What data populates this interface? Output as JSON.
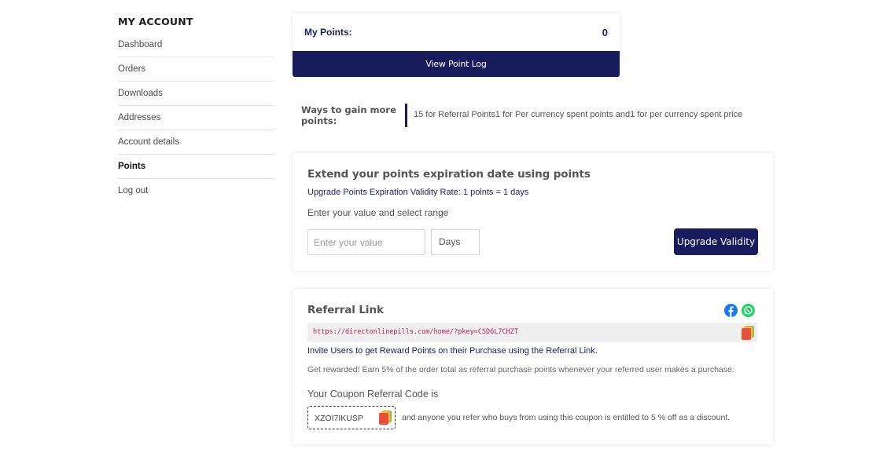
{
  "sidebar": {
    "title": "MY ACCOUNT",
    "items": [
      {
        "label": "Dashboard"
      },
      {
        "label": "Orders"
      },
      {
        "label": "Downloads"
      },
      {
        "label": "Addresses"
      },
      {
        "label": "Account details"
      },
      {
        "label": "Points",
        "active": true
      },
      {
        "label": "Log out"
      }
    ]
  },
  "points": {
    "label": "My Points:",
    "value": "0",
    "log_button": "View Point Log"
  },
  "ways": {
    "label": "Ways to gain more points:",
    "text": "15 for Referral Points1 for Per currency spent points and1 for per currency spent price"
  },
  "extend": {
    "title": "Extend your points expiration date using points",
    "rate": "Upgrade Points Expiration Validity Rate: 1 points = 1 days",
    "range_label": "Enter your value and select range",
    "input_placeholder": "Enter your value",
    "input_value": "",
    "select_value": "Days",
    "button": "Upgrade Validity"
  },
  "referral": {
    "title": "Referral Link",
    "link": "https://directonlinepills.com/home/?pkey=CSD6L7CHZT",
    "invite": "Invite Users to get Reward Points on their Purchase using the Referral Link.",
    "reward": "Get rewarded! Earn 5% of the order total as referral purchase points whenever your referred user makes a purchase.",
    "coupon_title": "Your Coupon Referral Code is",
    "coupon_code": "XZOI7IKUSP",
    "coupon_note": "and anyone you refer who buys from using this coupon is entitled to 5 % off as a discount.",
    "social_icons": [
      "facebook-icon",
      "whatsapp-icon"
    ]
  },
  "colors": {
    "navy": "#181c5c",
    "link": "#c2185b",
    "facebook": "#1877f2",
    "whatsapp": "#25d366"
  }
}
